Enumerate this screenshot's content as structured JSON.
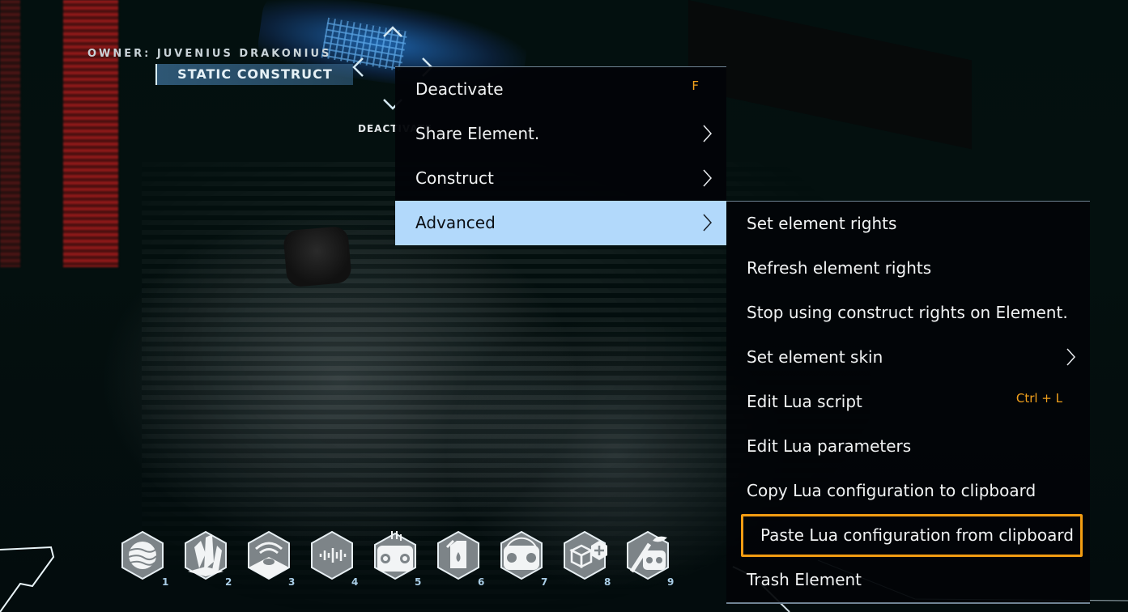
{
  "hud": {
    "owner_label": "OWNER: JUVENIUS DRAKONIUS",
    "construct_type": "STATIC CONSTRUCT",
    "action_hint": "DEACTIVATE"
  },
  "context_menu": {
    "items": [
      {
        "label": "Deactivate",
        "shortcut": "F",
        "has_submenu": false
      },
      {
        "label": "Share Element.",
        "shortcut": "",
        "has_submenu": true
      },
      {
        "label": "Construct",
        "shortcut": "",
        "has_submenu": true
      },
      {
        "label": "Advanced",
        "shortcut": "",
        "has_submenu": true,
        "active": true
      }
    ]
  },
  "advanced_submenu": {
    "items": [
      {
        "label": "Set element rights",
        "shortcut": "",
        "has_submenu": false
      },
      {
        "label": "Refresh element rights",
        "shortcut": "",
        "has_submenu": false
      },
      {
        "label": "Stop using construct rights on Element.",
        "shortcut": "",
        "has_submenu": false
      },
      {
        "label": "Set element skin",
        "shortcut": "",
        "has_submenu": true
      },
      {
        "label": "Edit Lua script",
        "shortcut": "Ctrl + L",
        "has_submenu": false
      },
      {
        "label": "Edit Lua parameters",
        "shortcut": "",
        "has_submenu": false
      },
      {
        "label": "Copy Lua configuration to clipboard",
        "shortcut": "",
        "has_submenu": false
      },
      {
        "label": "Paste Lua configuration from clipboard",
        "shortcut": "",
        "has_submenu": false,
        "focused": true
      },
      {
        "label": "Trash Element",
        "shortcut": "",
        "has_submenu": false
      }
    ]
  },
  "hotbar": {
    "slots": [
      {
        "key": "1",
        "icon": "planet-icon"
      },
      {
        "key": "2",
        "icon": "crystal-icon"
      },
      {
        "key": "3",
        "icon": "territory-scanner-icon"
      },
      {
        "key": "4",
        "icon": "sound-wave-icon"
      },
      {
        "key": "5",
        "icon": "build-mode-icon"
      },
      {
        "key": "6",
        "icon": "fuel-canister-icon"
      },
      {
        "key": "7",
        "icon": "construct-rotate-icon"
      },
      {
        "key": "8",
        "icon": "add-element-icon"
      },
      {
        "key": "9",
        "icon": "deploy-construct-icon"
      }
    ]
  },
  "colors": {
    "menu_bg": "#020408",
    "menu_active": "#b2d9fb",
    "shortcut": "#f0a01c",
    "focus_outline": "#f39c12",
    "menu_border": "#6f8393"
  }
}
